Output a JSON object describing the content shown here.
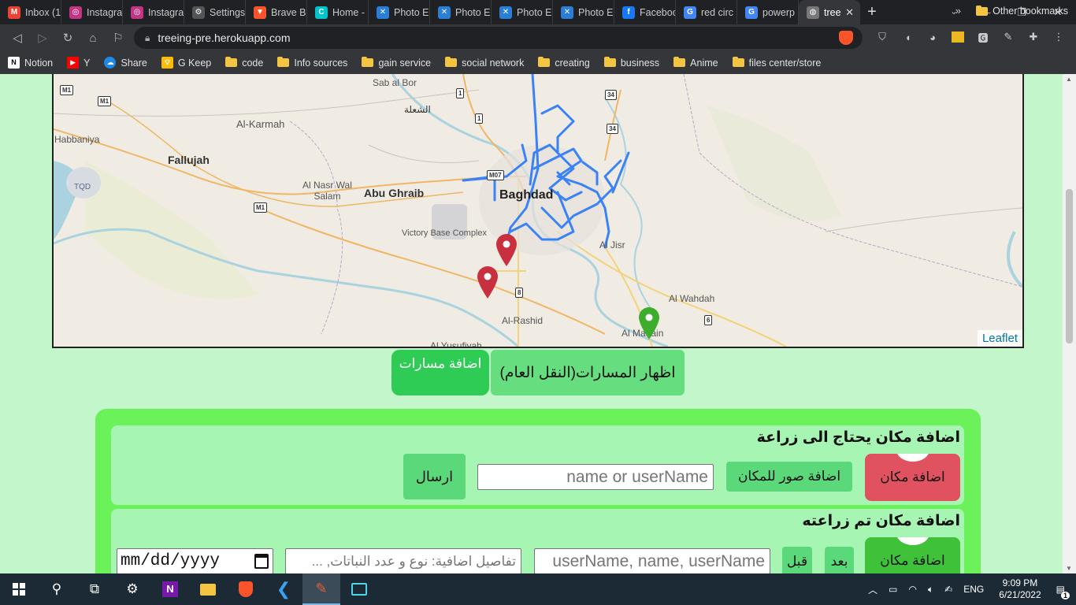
{
  "browser": {
    "tabs": [
      {
        "title": "Inbox (1",
        "icon": "gmail-icon",
        "color": "#ea4335",
        "glyph": "M"
      },
      {
        "title": "Instagra",
        "icon": "instagram-icon",
        "color": "#c13584",
        "glyph": "◎"
      },
      {
        "title": "Instagra",
        "icon": "instagram-icon",
        "color": "#c13584",
        "glyph": "◎"
      },
      {
        "title": "Settings",
        "icon": "gear-icon",
        "color": "#555555",
        "glyph": "⚙"
      },
      {
        "title": "Brave B",
        "icon": "brave-icon",
        "color": "#fb542b",
        "glyph": "▼"
      },
      {
        "title": "Home -",
        "icon": "canva-icon",
        "color": "#00c4cc",
        "glyph": "C"
      },
      {
        "title": "Photo E",
        "icon": "photo-editor-icon",
        "color": "#2a7fd4",
        "glyph": "✕"
      },
      {
        "title": "Photo E",
        "icon": "photo-editor-icon",
        "color": "#2a7fd4",
        "glyph": "✕"
      },
      {
        "title": "Photo E",
        "icon": "photo-editor-icon",
        "color": "#2a7fd4",
        "glyph": "✕"
      },
      {
        "title": "Photo E",
        "icon": "photo-editor-icon",
        "color": "#2a7fd4",
        "glyph": "✕"
      },
      {
        "title": "Faceboo",
        "icon": "facebook-icon",
        "color": "#1877f2",
        "glyph": "f"
      },
      {
        "title": "red circ",
        "icon": "google-icon",
        "color": "#4285f4",
        "glyph": "G"
      },
      {
        "title": "powerp",
        "icon": "google-icon",
        "color": "#4285f4",
        "glyph": "G"
      },
      {
        "title": "tree",
        "icon": "globe-icon",
        "color": "#777777",
        "glyph": "◍",
        "active": true
      }
    ],
    "url": "treeing-pre.herokuapp.com",
    "bookmarks": [
      {
        "label": "Notion",
        "icon": "notion-icon"
      },
      {
        "label": "Y",
        "icon": "youtube-icon"
      },
      {
        "label": "Share",
        "icon": "share-icon"
      },
      {
        "label": "G Keep",
        "icon": "keep-icon"
      },
      {
        "label": "code",
        "icon": "folder-icon"
      },
      {
        "label": "Info sources",
        "icon": "folder-icon"
      },
      {
        "label": "gain service",
        "icon": "folder-icon"
      },
      {
        "label": "social network",
        "icon": "folder-icon"
      },
      {
        "label": "creating",
        "icon": "folder-icon"
      },
      {
        "label": "business",
        "icon": "folder-icon"
      },
      {
        "label": "Anime",
        "icon": "folder-icon"
      },
      {
        "label": "files center/store",
        "icon": "folder-icon"
      }
    ],
    "other_bookmarks": "Other bookmarks"
  },
  "map": {
    "attribution": "Leaflet",
    "labels": {
      "sab_al_bor": "Sab al Bor",
      "shula": "الشعلة",
      "al_karmah": "Al-Karmah",
      "habbaniya": "Habbaniya",
      "fallujah": "Fallujah",
      "tqd": "TQD",
      "al_nasr_wal_salam": "Al Nasr Wal\nSalam",
      "abu_ghraib": "Abu Ghraib",
      "baghdad": "Baghdad",
      "victory_base": "Victory Base Complex",
      "al_jisr": "Al Jisr",
      "al_wahdah": "Al Wahdah",
      "al_rashid": "Al-Rashid",
      "al_madain": "Al Madain",
      "al_yousifiyah": "Al Yusufiyah"
    },
    "road_shields": [
      "M1",
      "M1",
      "1",
      "1",
      "34",
      "34",
      "M1",
      "M07",
      "8",
      "6"
    ],
    "marker_colors": {
      "red": "#c8303f",
      "green": "#3cae2c",
      "route": "#3b82f6"
    }
  },
  "route_buttons": {
    "add_routes": "اضافة مسارات",
    "show_routes": "اظهار المسارات(النقل العام)"
  },
  "needs_planting": {
    "title": "اضافة مكان يحتاج الى زراعة",
    "add_place": "اضافة مكان",
    "add_photos": "اضافة صور للمكان",
    "name_placeholder": "name or userName",
    "send": "ارسال"
  },
  "planted": {
    "title": "اضافة مكان تم زراعته",
    "add_place": "اضافة مكان",
    "after": "بعد",
    "before": "قبل",
    "names_placeholder": "userName, name, userName",
    "details_placeholder": "تفاصيل اضافية: نوع و عدد النباتات, ...",
    "date_placeholder": "mm/dd/yyyy"
  },
  "taskbar": {
    "language": "ENG",
    "time": "9:09 PM",
    "date": "6/21/2022",
    "notifications": "1"
  }
}
